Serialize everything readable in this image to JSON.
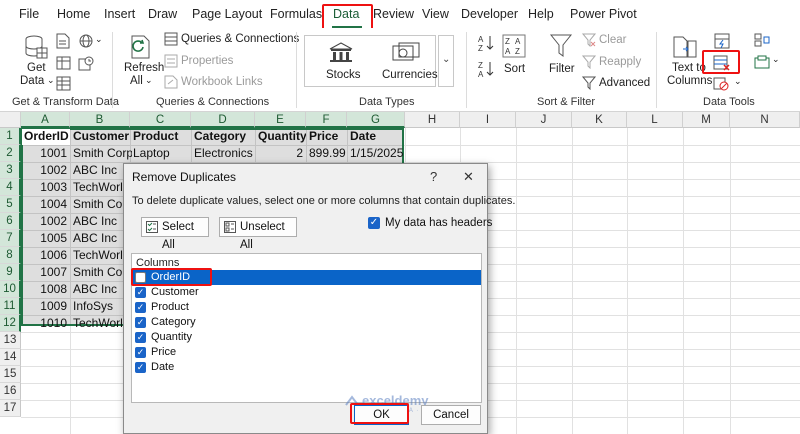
{
  "menu": {
    "items": [
      "File",
      "Home",
      "Insert",
      "Draw",
      "Page Layout",
      "Formulas",
      "Data",
      "Review",
      "View",
      "Developer",
      "Help",
      "Power Pivot"
    ],
    "active": "Data"
  },
  "ribbon": {
    "get_transform": {
      "get_data_line1": "Get",
      "get_data_line2": "Data",
      "group_label": "Get & Transform Data"
    },
    "queries": {
      "refresh_line1": "Refresh",
      "refresh_line2": "All",
      "queries_connections": "Queries & Connections",
      "properties": "Properties",
      "workbook_links": "Workbook Links",
      "group_label": "Queries & Connections"
    },
    "data_types": {
      "stocks": "Stocks",
      "currencies": "Currencies",
      "group_label": "Data Types"
    },
    "sort_filter": {
      "sort": "Sort",
      "filter": "Filter",
      "clear": "Clear",
      "reapply": "Reapply",
      "advanced": "Advanced",
      "group_label": "Sort & Filter"
    },
    "data_tools": {
      "text_to_line1": "Text to",
      "text_to_line2": "Columns",
      "group_label": "Data Tools"
    }
  },
  "sheet": {
    "columns": [
      "A",
      "B",
      "C",
      "D",
      "E",
      "F",
      "G",
      "H",
      "I",
      "J",
      "K",
      "L",
      "M",
      "N"
    ],
    "rows": [
      "1",
      "2",
      "3",
      "4",
      "5",
      "6",
      "7",
      "8",
      "9",
      "10",
      "11",
      "12",
      "13",
      "14",
      "15",
      "16",
      "17"
    ],
    "headers": [
      "OrderID",
      "Customer",
      "Product",
      "Category",
      "Quantity",
      "Price",
      "Date"
    ],
    "data": [
      [
        "1001",
        "Smith Corp",
        "Laptop",
        "Electronics",
        "2",
        "899.99",
        "1/15/2025"
      ],
      [
        "1002",
        "ABC Inc",
        "",
        "",
        "",
        "",
        ""
      ],
      [
        "1003",
        "TechWorld",
        "",
        "",
        "",
        "",
        ""
      ],
      [
        "1004",
        "Smith Corp",
        "",
        "",
        "",
        "",
        ""
      ],
      [
        "1002",
        "ABC Inc",
        "",
        "",
        "",
        "",
        ""
      ],
      [
        "1005",
        "ABC Inc",
        "",
        "",
        "",
        "",
        ""
      ],
      [
        "1006",
        "TechWorld",
        "",
        "",
        "",
        "",
        ""
      ],
      [
        "1007",
        "Smith Corp",
        "",
        "",
        "",
        "",
        ""
      ],
      [
        "1008",
        "ABC Inc",
        "",
        "",
        "",
        "",
        ""
      ],
      [
        "1009",
        "InfoSys",
        "",
        "",
        "",
        "",
        ""
      ],
      [
        "1010",
        "TechWorld",
        "",
        "",
        "",
        "",
        ""
      ]
    ]
  },
  "dialog": {
    "title": "Remove Duplicates",
    "help": "?",
    "close": "✕",
    "instruction": "To delete duplicate values, select one or more columns that contain duplicates.",
    "select_all": "Select All",
    "unselect_all": "Unselect All",
    "has_headers": "My data has headers",
    "columns_label": "Columns",
    "columns": [
      {
        "label": "OrderID",
        "checked": false
      },
      {
        "label": "Customer",
        "checked": true
      },
      {
        "label": "Product",
        "checked": true
      },
      {
        "label": "Category",
        "checked": true
      },
      {
        "label": "Quantity",
        "checked": true
      },
      {
        "label": "Price",
        "checked": true
      },
      {
        "label": "Date",
        "checked": true
      }
    ],
    "ok": "OK",
    "cancel": "Cancel"
  },
  "watermark": {
    "line1": "exceldemy",
    "line2": "EXCEL · DATA · BI"
  },
  "colors": {
    "excel_green": "#217346",
    "highlight_red": "#e11111",
    "selection_blue": "#0a64c8"
  }
}
